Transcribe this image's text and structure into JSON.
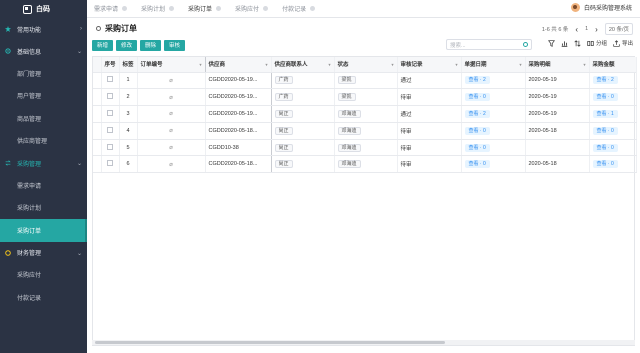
{
  "app": {
    "logo_text": "白码",
    "user_name": "白码采购管理系统"
  },
  "sidebar": {
    "groups": [
      {
        "label": "常用功能",
        "items": []
      },
      {
        "label": "基础信息",
        "items": [
          "部门管理",
          "用户管理",
          "商品管理",
          "供应商管理"
        ]
      },
      {
        "label": "采购管理",
        "items": [
          "需求申请",
          "采购计划",
          "采购订单"
        ]
      },
      {
        "label": "财务管理",
        "items": [
          "采购应付",
          "付款记录"
        ]
      }
    ],
    "active_item": "采购订单"
  },
  "tabs": [
    {
      "label": "需求申请"
    },
    {
      "label": "采购计划"
    },
    {
      "label": "采购订单"
    },
    {
      "label": "采购应付"
    },
    {
      "label": "付款记录"
    }
  ],
  "page": {
    "title": "采购订单"
  },
  "pager": {
    "range": "1-6 共 6 条",
    "page": "1",
    "page_size": "20 条/页"
  },
  "toolbar": {
    "add": "新增",
    "edit": "修改",
    "delete": "删除",
    "audit": "审核",
    "search_placeholder": "搜索...",
    "group": "分组",
    "export": "导出"
  },
  "table": {
    "columns": [
      "序号",
      "标签",
      "订单编号",
      "供应商",
      "供应商联系人",
      "状态",
      "审核记录",
      "单据日期",
      "采购明细",
      "采购金额"
    ],
    "rows": [
      {
        "no": "1",
        "order": "CGDD2020-05-19...",
        "supplier": "广药",
        "contact": "梁凯",
        "status": "通过",
        "audit": "查看 · 2",
        "date": "2020-05-19",
        "detail": "查看 · 2",
        "amount": "320"
      },
      {
        "no": "2",
        "order": "CGDD2020-05-19...",
        "supplier": "广药",
        "contact": "梁凯",
        "status": "待审",
        "audit": "查看 · 0",
        "date": "2020-05-19",
        "detail": "查看 · 0",
        "amount": "0"
      },
      {
        "no": "3",
        "order": "CGDD2020-05-19...",
        "supplier": "尚正",
        "contact": "邓海迪",
        "status": "通过",
        "audit": "查看 · 2",
        "date": "2020-05-19",
        "detail": "查看 · 1",
        "amount": "8000"
      },
      {
        "no": "4",
        "order": "CGDD2020-05-18...",
        "supplier": "尚正",
        "contact": "邓海迪",
        "status": "待审",
        "audit": "查看 · 0",
        "date": "2020-05-18",
        "detail": "查看 · 0",
        "amount": "0"
      },
      {
        "no": "5",
        "order": "CGDD10-38",
        "supplier": "尚正",
        "contact": "邓海迪",
        "status": "待审",
        "audit": "查看 · 0",
        "date": "",
        "detail": "查看 · 0",
        "amount": "0"
      },
      {
        "no": "6",
        "order": "CGDD2020-05-18...",
        "supplier": "尚正",
        "contact": "邓海迪",
        "status": "待审",
        "audit": "查看 · 0",
        "date": "2020-05-18",
        "detail": "查看 · 0",
        "amount": "0"
      }
    ]
  },
  "colors": {
    "accent": "#25a7a3",
    "sidebar_bg": "#2b3344",
    "badge_blue": "#2d8cf0"
  }
}
